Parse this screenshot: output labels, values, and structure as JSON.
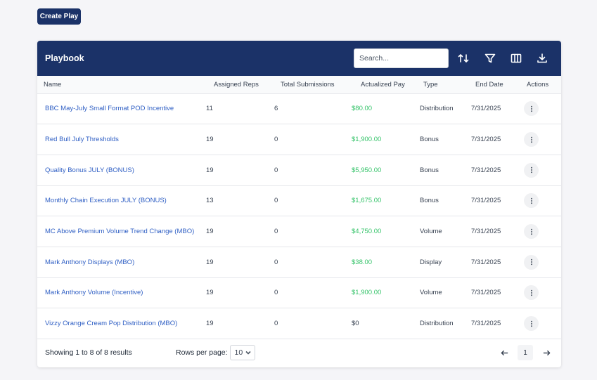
{
  "toolbar": {
    "create_label": "Create Play"
  },
  "card": {
    "title": "Playbook",
    "search_placeholder": "Search..."
  },
  "columns": {
    "name": "Name",
    "reps": "Assigned Reps",
    "subs": "Total Submissions",
    "pay": "Actualized Pay",
    "type": "Type",
    "end": "End Date",
    "actions": "Actions"
  },
  "rows": [
    {
      "name": "BBC May-July Small Format POD Incentive",
      "reps": "11",
      "subs": "6",
      "pay": "$80.00",
      "type": "Distribution",
      "end": "7/31/2025"
    },
    {
      "name": "Red Bull July Thresholds",
      "reps": "19",
      "subs": "0",
      "pay": "$1,900.00",
      "type": "Bonus",
      "end": "7/31/2025"
    },
    {
      "name": "Quality Bonus JULY (BONUS)",
      "reps": "19",
      "subs": "0",
      "pay": "$5,950.00",
      "type": "Bonus",
      "end": "7/31/2025"
    },
    {
      "name": "Monthly Chain Execution JULY (BONUS)",
      "reps": "13",
      "subs": "0",
      "pay": "$1,675.00",
      "type": "Bonus",
      "end": "7/31/2025"
    },
    {
      "name": "MC Above Premium Volume Trend Change (MBO)",
      "reps": "19",
      "subs": "0",
      "pay": "$4,750.00",
      "type": "Volume",
      "end": "7/31/2025"
    },
    {
      "name": "Mark Anthony Displays (MBO)",
      "reps": "19",
      "subs": "0",
      "pay": "$38.00",
      "type": "Display",
      "end": "7/31/2025"
    },
    {
      "name": "Mark Anthony Volume (Incentive)",
      "reps": "19",
      "subs": "0",
      "pay": "$1,900.00",
      "type": "Volume",
      "end": "7/31/2025"
    },
    {
      "name": "Vizzy Orange Cream Pop Distribution (MBO)",
      "reps": "19",
      "subs": "0",
      "pay": "$0",
      "type": "Distribution",
      "end": "7/31/2025"
    }
  ],
  "footer": {
    "showing": "Showing 1 to 8 of 8 results",
    "rows_per_page_label": "Rows per page:",
    "rows_per_page_value": "10",
    "current_page": "1"
  },
  "colors": {
    "brand": "#1b3268",
    "link": "#2f5fc4",
    "pay_positive": "#34c369"
  }
}
